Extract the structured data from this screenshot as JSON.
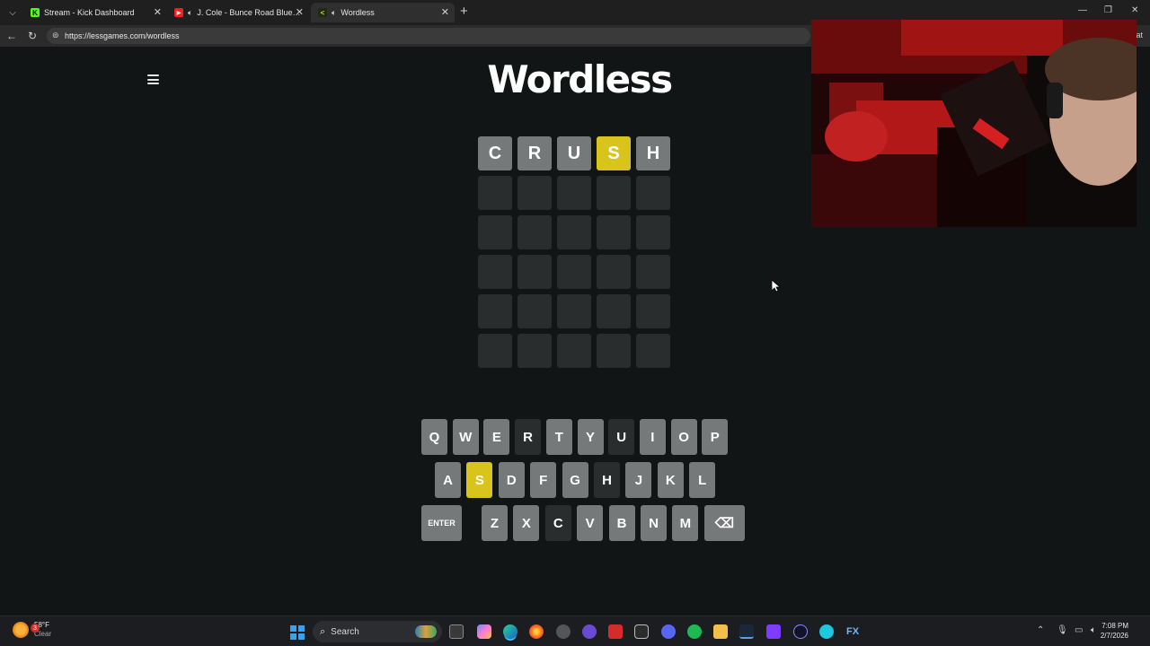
{
  "browser": {
    "tabs": [
      {
        "label": "Stream - Kick Dashboard",
        "active": false
      },
      {
        "label": "J. Cole - Bunce Road Blues (O",
        "active": false
      },
      {
        "label": "Wordless",
        "active": true
      }
    ],
    "url": "https://lessgames.com/wordless",
    "addr_right_text": "at"
  },
  "game": {
    "title": "Wordless",
    "board": [
      [
        {
          "letter": "C",
          "state": "absent"
        },
        {
          "letter": "R",
          "state": "absent"
        },
        {
          "letter": "U",
          "state": "absent"
        },
        {
          "letter": "S",
          "state": "present"
        },
        {
          "letter": "H",
          "state": "absent"
        }
      ],
      [
        {
          "letter": "",
          "state": "empty"
        },
        {
          "letter": "",
          "state": "empty"
        },
        {
          "letter": "",
          "state": "empty"
        },
        {
          "letter": "",
          "state": "empty"
        },
        {
          "letter": "",
          "state": "empty"
        }
      ],
      [
        {
          "letter": "",
          "state": "empty"
        },
        {
          "letter": "",
          "state": "empty"
        },
        {
          "letter": "",
          "state": "empty"
        },
        {
          "letter": "",
          "state": "empty"
        },
        {
          "letter": "",
          "state": "empty"
        }
      ],
      [
        {
          "letter": "",
          "state": "empty"
        },
        {
          "letter": "",
          "state": "empty"
        },
        {
          "letter": "",
          "state": "empty"
        },
        {
          "letter": "",
          "state": "empty"
        },
        {
          "letter": "",
          "state": "empty"
        }
      ],
      [
        {
          "letter": "",
          "state": "empty"
        },
        {
          "letter": "",
          "state": "empty"
        },
        {
          "letter": "",
          "state": "empty"
        },
        {
          "letter": "",
          "state": "empty"
        },
        {
          "letter": "",
          "state": "empty"
        }
      ],
      [
        {
          "letter": "",
          "state": "empty"
        },
        {
          "letter": "",
          "state": "empty"
        },
        {
          "letter": "",
          "state": "empty"
        },
        {
          "letter": "",
          "state": "empty"
        },
        {
          "letter": "",
          "state": "empty"
        }
      ]
    ],
    "keyboard": [
      [
        {
          "label": "Q",
          "state": "unused"
        },
        {
          "label": "W",
          "state": "unused"
        },
        {
          "label": "E",
          "state": "unused"
        },
        {
          "label": "R",
          "state": "used"
        },
        {
          "label": "T",
          "state": "unused"
        },
        {
          "label": "Y",
          "state": "unused"
        },
        {
          "label": "U",
          "state": "used"
        },
        {
          "label": "I",
          "state": "unused"
        },
        {
          "label": "O",
          "state": "unused"
        },
        {
          "label": "P",
          "state": "unused"
        }
      ],
      [
        {
          "label": "A",
          "state": "unused"
        },
        {
          "label": "S",
          "state": "present"
        },
        {
          "label": "D",
          "state": "unused"
        },
        {
          "label": "F",
          "state": "unused"
        },
        {
          "label": "G",
          "state": "unused"
        },
        {
          "label": "H",
          "state": "used"
        },
        {
          "label": "J",
          "state": "unused"
        },
        {
          "label": "K",
          "state": "unused"
        },
        {
          "label": "L",
          "state": "unused"
        }
      ],
      [
        {
          "label": "ENTER",
          "state": "unused",
          "wide": true
        },
        {
          "label": "Z",
          "state": "unused"
        },
        {
          "label": "X",
          "state": "unused"
        },
        {
          "label": "C",
          "state": "used"
        },
        {
          "label": "V",
          "state": "unused"
        },
        {
          "label": "B",
          "state": "unused"
        },
        {
          "label": "N",
          "state": "unused"
        },
        {
          "label": "M",
          "state": "unused"
        },
        {
          "label": "⌫",
          "state": "unused",
          "icon": "backspace-icon"
        }
      ]
    ],
    "colors": {
      "absent": "#75797a",
      "present": "#d9c41c",
      "empty": "#2a2d2e",
      "used": "#2a2d2e"
    }
  },
  "taskbar": {
    "weather": {
      "temp": "58°F",
      "condition": "Clear",
      "badge": "3"
    },
    "search_placeholder": "Search",
    "clock": {
      "time": "7:08 PM",
      "date": "2/7/2026"
    }
  }
}
